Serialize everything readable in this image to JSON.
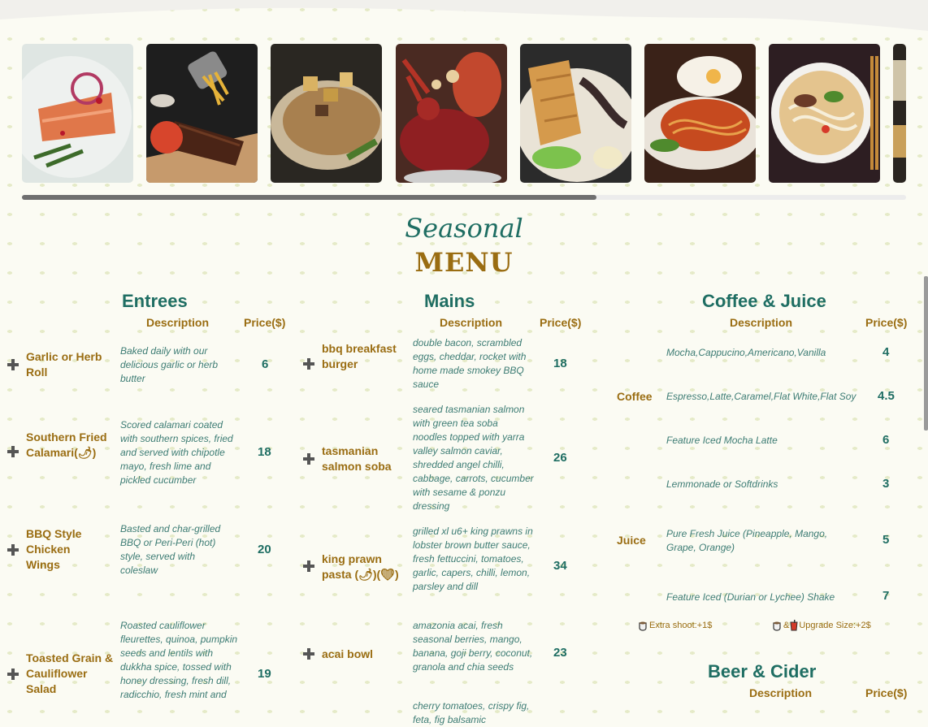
{
  "header": {
    "kicker": "Seasonal",
    "title": "MENU"
  },
  "gallery": {
    "images": [
      {
        "name": "salmon-dish",
        "icon": "salmon-dish-photo"
      },
      {
        "name": "ribs-and-fries",
        "icon": "ribs-photo"
      },
      {
        "name": "pork-chop",
        "icon": "pork-chop-photo"
      },
      {
        "name": "lobster-platter",
        "icon": "lobster-photo"
      },
      {
        "name": "katsu-ramen",
        "icon": "katsu-photo"
      },
      {
        "name": "spaghetti",
        "icon": "spaghetti-photo"
      },
      {
        "name": "pho-soup",
        "icon": "pho-photo"
      },
      {
        "name": "partial-dish",
        "icon": "food-photo"
      }
    ],
    "scroll_progress": 0.65
  },
  "entrees": {
    "title": "Entrees",
    "desc_label": "Description",
    "price_label": "Price($)",
    "items": [
      {
        "name": "Garlic or Herb Roll",
        "desc": "Baked daily with our delicious garlic or herb butter",
        "price": "6"
      },
      {
        "name": "Southern Fried Calamari(🌶)",
        "desc": "Scored calamari coated with southern spices, fried and served with chipotle mayo, fresh lime and pickled cucumber",
        "price": "18"
      },
      {
        "name": "BBQ Style Chicken Wings",
        "desc": "Basted and char-grilled BBQ or Peri-Peri (hot) style, served with coleslaw",
        "price": "20"
      },
      {
        "name": "Toasted Grain & Cauliflower Salad",
        "desc": "Roasted cauliflower fleurettes, quinoa, pumpkin seeds and lentils with dukkha spice, tossed with honey dressing, fresh dill, radicchio, fresh mint and",
        "price": "19"
      }
    ]
  },
  "mains": {
    "title": "Mains",
    "desc_label": "Description",
    "price_label": "Price($)",
    "items": [
      {
        "name": "bbq breakfast burger",
        "desc": "double bacon, scrambled eggs, cheddar, rocket with home made smokey BBQ sauce",
        "price": "18"
      },
      {
        "name": "tasmanian salmon soba",
        "desc": "seared tasmanian salmon with green tea soba noodles topped with yarra valley salmon caviar, shredded angel chilli, cabbage, carrots, cucumber with sesame & ponzu dressing",
        "price": "26"
      },
      {
        "name": "king prawn pasta (🌶)(❤)",
        "desc": "grilled xl u6+ king prawns in lobster brown butter sauce, fresh fettuccini, tomatoes, garlic, capers, chilli, lemon, parsley and dill",
        "price": "34"
      },
      {
        "name": "acai bowl",
        "desc": "amazonia acai, fresh seasonal berries, mango, banana, goji berry, coconut, granola and chia seeds",
        "price": "23"
      },
      {
        "name": "",
        "desc": "cherry tomatoes, crispy fig, feta, fig balsamic",
        "price": ""
      }
    ]
  },
  "coffee_juice": {
    "title": "Coffee & Juice",
    "desc_label": "Description",
    "price_label": "Price($)",
    "categories": [
      "Coffee",
      "Juice"
    ],
    "items": [
      {
        "desc": "Mocha,Cappucino,Americano,Vanilla",
        "price": "4"
      },
      {
        "desc": "Espresso,Latte,Caramel,Flat White,Flat Soy",
        "price": "4.5"
      },
      {
        "desc": "Feature Iced Mocha Latte",
        "price": "6"
      },
      {
        "desc": "Lemmonade or Softdrinks",
        "price": "3"
      },
      {
        "desc": "Pure Fresh Juice (Pineapple, Mango, Grape, Orange)",
        "price": "5"
      },
      {
        "desc": "Feature Iced (Durian or Lychee) Shake",
        "price": "7"
      }
    ],
    "notes": {
      "extra_shot": "Extra shoot:+1$",
      "upgrade_amp": "&",
      "upgrade": "Upgrade Size:+2$"
    }
  },
  "beer_cider": {
    "title": "Beer & Cider",
    "desc_label": "Description",
    "price_label": "Price($)"
  },
  "colors": {
    "accent_green": "#1f6e63",
    "accent_gold": "#9a6d12",
    "background": "#fbfbf3"
  }
}
